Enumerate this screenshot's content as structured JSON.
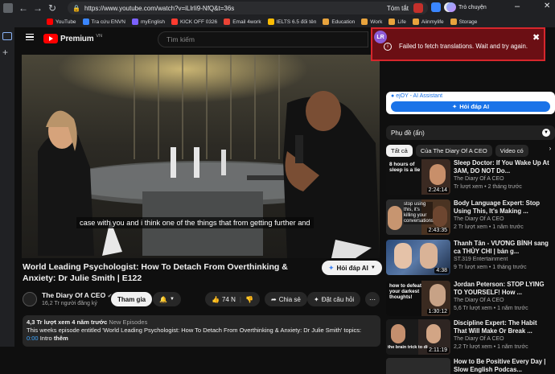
{
  "browser": {
    "url": "https://www.youtube.com/watch?v=iLlrIi9-NfQ&t=36s",
    "summarize_label": "Tóm tắt",
    "chat_label": "Trò chuyện"
  },
  "bookmarks": [
    {
      "label": "YouTube",
      "color": "#ff0000"
    },
    {
      "label": "Tra cứu ENVN",
      "color": "#3a86ff"
    },
    {
      "label": "myEnglish",
      "color": "#7b61ff"
    },
    {
      "label": "KICK OFF 0326",
      "color": "#ff3b30"
    },
    {
      "label": "Email 4work",
      "color": "#ea4335"
    },
    {
      "label": "IELTS 6.5 đối tên",
      "color": "#fbbc04"
    },
    {
      "label": "Education",
      "color": "#e8a33d"
    },
    {
      "label": "Work",
      "color": "#e8a33d"
    },
    {
      "label": "Life",
      "color": "#e8a33d"
    },
    {
      "label": "Aiinmylife",
      "color": "#e8a33d"
    },
    {
      "label": "Storage",
      "color": "#e8a33d"
    }
  ],
  "youtube": {
    "logo_label": "Premium",
    "logo_region": "VN",
    "search_placeholder": "Tìm kiếm"
  },
  "video": {
    "caption": "case with you and i think one of the things that from getting further and",
    "title": "World Leading Psychologist: How To Detach From Overthinking & Anxiety: Dr Julie Smith | E122",
    "ask_label": "Hỏi đáp AI",
    "channel_name": "The Diary Of A CEO",
    "subscribers": "16,2 Tr người đăng ký",
    "join_label": "Tham gia",
    "likes": "74 N",
    "share_label": "Chia sẻ",
    "ask_question_label": "Đặt câu hỏi",
    "views_time": "4,3 Tr lượt xem  4 năm trước",
    "episode_label": "New Episodes",
    "desc_text": "This weeks episode entitled  'World Leading Psychologist: How To Detach From Overthinking & Anxiety: Dr Julie Smith' topics:",
    "chapter_time": "0:00",
    "chapter_label": "Intro",
    "more_label": "thêm"
  },
  "ai_panel": {
    "name": "ejOY - AI Assistant",
    "button_label": "Hỏi đáp AI"
  },
  "error": {
    "message": "Failed to fetch translations. Wait and try again."
  },
  "sidebar": {
    "subtitles_label": "Phụ đề (ẩn)",
    "chips": [
      "Tất cả",
      "Của The Diary Of A CEO",
      "Video có"
    ],
    "videos": [
      {
        "title": "Sleep Doctor: If You Wake Up At 3AM, DO NOT Do...",
        "channel": "The Diary Of A CEO",
        "meta": "Tr lượt xem • 2 tháng trước",
        "duration": "2:24:14",
        "thumb_text": "8 hours of sleep is a lie"
      },
      {
        "title": "Body Language Expert: Stop Using This, It's Making ...",
        "channel": "The Diary Of A CEO",
        "meta": "2 Tr lượt xem • 1 năm trước",
        "duration": "2:43:35",
        "thumb_text": "stop using this, it's killing your conversations!"
      },
      {
        "title": "Thanh Tân - VƯƠNG BÌNH sang ca THỦY CHI | bản g...",
        "channel": "ST.319 Entertainment",
        "meta": "9 Tr lượt xem • 1 tháng trước",
        "duration": "4:38",
        "thumb_text": ""
      },
      {
        "title": "Jordan Peterson: STOP LYING TO YOURSELF! How ...",
        "channel": "The Diary Of A CEO",
        "meta": "5,6 Tr lượt xem • 1 năm trước",
        "duration": "1:30:12",
        "thumb_text": "how to defeat your darkest thoughts!"
      },
      {
        "title": "Discipline Expert: The Habit That Will Make Or Break ...",
        "channel": "The Diary Of A CEO",
        "meta": "2,2 Tr lượt xem • 1 năm trước",
        "duration": "2:11:19",
        "thumb_text": "the brain trick to discipline ins..."
      },
      {
        "title": "How to Be Positive Every Day | Slow English Podcas...",
        "channel": "",
        "meta": "",
        "duration": "",
        "thumb_text": ""
      }
    ]
  }
}
